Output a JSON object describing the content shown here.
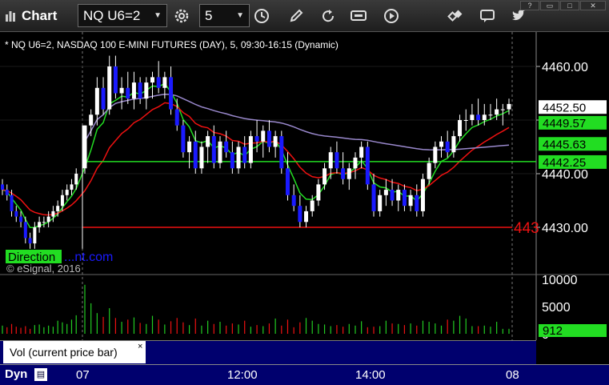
{
  "toolbar": {
    "app_title": "Chart",
    "symbol_value": "NQ U6=2",
    "interval_value": "5",
    "colors": {
      "background": "#2a2a2a"
    }
  },
  "chart_data": {
    "type": "candlestick",
    "title": "* NQ U6=2, NASDAQ 100 E-MINI FUTURES (DAY), 5, 09:30-16:15 (Dynamic)",
    "watermark": "© eSignal, 2016",
    "direction_label": "Direction",
    "overlay_text": "...nt.com",
    "y_ticks": [
      "4460.00",
      "4450.00",
      "4440.00",
      "4430.00"
    ],
    "y_tick_values": [
      4460,
      4450,
      4440,
      4430
    ],
    "ylim": [
      4423,
      4465
    ],
    "price_tags": [
      {
        "text": "4452.50",
        "value": 4452.5,
        "bg": "#ffffff",
        "fg": "#000000"
      },
      {
        "text": "4449.57",
        "value": 4449.57,
        "bg": "#22dd22",
        "fg": "#000000"
      },
      {
        "text": "4445.63",
        "value": 4445.63,
        "bg": "#22dd22",
        "fg": "#000000"
      },
      {
        "text": "4442.25",
        "value": 4442.25,
        "bg": "#22dd22",
        "fg": "#000000"
      }
    ],
    "truncated_red_label": "443",
    "red_level": 4430,
    "green_level": 4442.25,
    "x_ticks": [
      "07",
      "12:00",
      "14:00",
      "08"
    ],
    "colors": {
      "up": "#ffffff",
      "down": "#1a1aff",
      "ma_fast": "#22dd22",
      "ma_slow": "#ee1111",
      "vwap": "#9988cc",
      "red_line": "#ee1111",
      "green_line": "#22dd22"
    },
    "prev_session_closes": [
      4437,
      4436,
      4433,
      4432,
      4431,
      4428,
      4427,
      4430,
      4431,
      4431,
      4432,
      4433,
      4434,
      4436,
      4437,
      4438,
      4440
    ],
    "session_candles": [
      [
        4441,
        4449,
        4440,
        4449
      ],
      [
        4449,
        4452,
        4447,
        4451
      ],
      [
        4451,
        4458,
        4449,
        4456
      ],
      [
        4456,
        4458,
        4451,
        4452
      ],
      [
        4452,
        4462,
        4451,
        4460
      ],
      [
        4460,
        4462,
        4454,
        4455
      ],
      [
        4455,
        4458,
        4452,
        4456
      ],
      [
        4456,
        4459,
        4453,
        4454
      ],
      [
        4454,
        4459,
        4452,
        4457
      ],
      [
        4457,
        4458,
        4453,
        4454
      ],
      [
        4454,
        4458,
        4452,
        4457
      ],
      [
        4457,
        4459,
        4454,
        4458
      ],
      [
        4458,
        4461,
        4455,
        4456
      ],
      [
        4456,
        4459,
        4454,
        4458
      ],
      [
        4458,
        4460,
        4451,
        4452
      ],
      [
        4452,
        4454,
        4448,
        4449
      ],
      [
        4449,
        4450,
        4443,
        4444
      ],
      [
        4444,
        4447,
        4441,
        4446
      ],
      [
        4446,
        4448,
        4440,
        4441
      ],
      [
        4441,
        4446,
        4440,
        4445
      ],
      [
        4445,
        4448,
        4442,
        4447
      ],
      [
        4447,
        4449,
        4441,
        4442
      ],
      [
        4442,
        4447,
        4441,
        4446
      ],
      [
        4446,
        4448,
        4443,
        4444
      ],
      [
        4444,
        4446,
        4440,
        4441
      ],
      [
        4441,
        4446,
        4440,
        4445
      ],
      [
        4445,
        4447,
        4441,
        4442
      ],
      [
        4442,
        4448,
        4441,
        4447
      ],
      [
        4447,
        4450,
        4444,
        4446
      ],
      [
        4446,
        4449,
        4443,
        4448
      ],
      [
        4448,
        4450,
        4444,
        4445
      ],
      [
        4445,
        4448,
        4443,
        4447
      ],
      [
        4447,
        4448,
        4440,
        4441
      ],
      [
        4441,
        4444,
        4435,
        4436
      ],
      [
        4436,
        4438,
        4433,
        4434
      ],
      [
        4434,
        4436,
        4430,
        4431
      ],
      [
        4431,
        4434,
        4430,
        4433
      ],
      [
        4433,
        4436,
        4432,
        4435
      ],
      [
        4435,
        4439,
        4434,
        4438
      ],
      [
        4438,
        4442,
        4437,
        4441
      ],
      [
        4441,
        4445,
        4439,
        4444
      ],
      [
        4444,
        4446,
        4440,
        4441
      ],
      [
        4441,
        4444,
        4438,
        4439
      ],
      [
        4439,
        4442,
        4437,
        4441
      ],
      [
        4441,
        4444,
        4439,
        4443
      ],
      [
        4443,
        4446,
        4441,
        4445
      ],
      [
        4445,
        4446,
        4437,
        4438
      ],
      [
        4438,
        4440,
        4432,
        4433
      ],
      [
        4433,
        4437,
        4432,
        4436
      ],
      [
        4436,
        4439,
        4434,
        4437
      ],
      [
        4437,
        4439,
        4434,
        4435
      ],
      [
        4435,
        4438,
        4433,
        4437
      ],
      [
        4437,
        4438,
        4433,
        4434
      ],
      [
        4434,
        4437,
        4433,
        4436
      ],
      [
        4436,
        4438,
        4432,
        4433
      ],
      [
        4433,
        4440,
        4432,
        4439
      ],
      [
        4439,
        4443,
        4438,
        4442
      ],
      [
        4442,
        4446,
        4441,
        4445
      ],
      [
        4445,
        4447,
        4443,
        4446
      ],
      [
        4446,
        4448,
        4443,
        4444
      ],
      [
        4444,
        4448,
        4443,
        4447
      ],
      [
        4447,
        4451,
        4446,
        4450
      ],
      [
        4450,
        4452,
        4448,
        4450
      ],
      [
        4450,
        4453,
        4449,
        4451
      ],
      [
        4451,
        4454,
        4449,
        4450
      ],
      [
        4450,
        4453,
        4449,
        4451
      ],
      [
        4451,
        4453,
        4450,
        4451
      ],
      [
        4451,
        4454,
        4450,
        4452
      ],
      [
        4452,
        4453,
        4449,
        4452
      ],
      [
        4452,
        4454,
        4451,
        4453
      ]
    ],
    "volume": {
      "y_ticks": [
        "10000",
        "5000",
        "0"
      ],
      "y_tick_values": [
        10000,
        5000,
        0
      ],
      "ylim": [
        0,
        11000
      ],
      "last_tag": "912",
      "label": "Vol (current price bar)",
      "prev_values": [
        1500,
        1200,
        1800,
        1300,
        1100,
        1400,
        900,
        1600,
        1700,
        1200,
        1500,
        1300,
        2400,
        2100,
        1800,
        2600,
        3400
      ],
      "session_values": [
        9000,
        5600,
        3800,
        3100,
        4700,
        2900,
        2200,
        2600,
        3000,
        2000,
        1800,
        3300,
        2600,
        1700,
        2300,
        2900,
        2100,
        1600,
        2800,
        1500,
        2400,
        1800,
        2200,
        1500,
        1900,
        1700,
        2400,
        1300,
        1600,
        1400,
        1900,
        2800,
        1500,
        2600,
        1200,
        2100,
        2900,
        2400,
        1800,
        1700,
        1400,
        1600,
        1300,
        1800,
        1500,
        2300,
        1200,
        1300,
        1400,
        2400,
        1900,
        1800,
        1600,
        1900,
        1500,
        2400,
        2200,
        1900,
        1500,
        2600,
        2400,
        3300,
        2800,
        1400,
        1400,
        1500,
        1300,
        2200,
        900,
        912
      ]
    }
  }
}
